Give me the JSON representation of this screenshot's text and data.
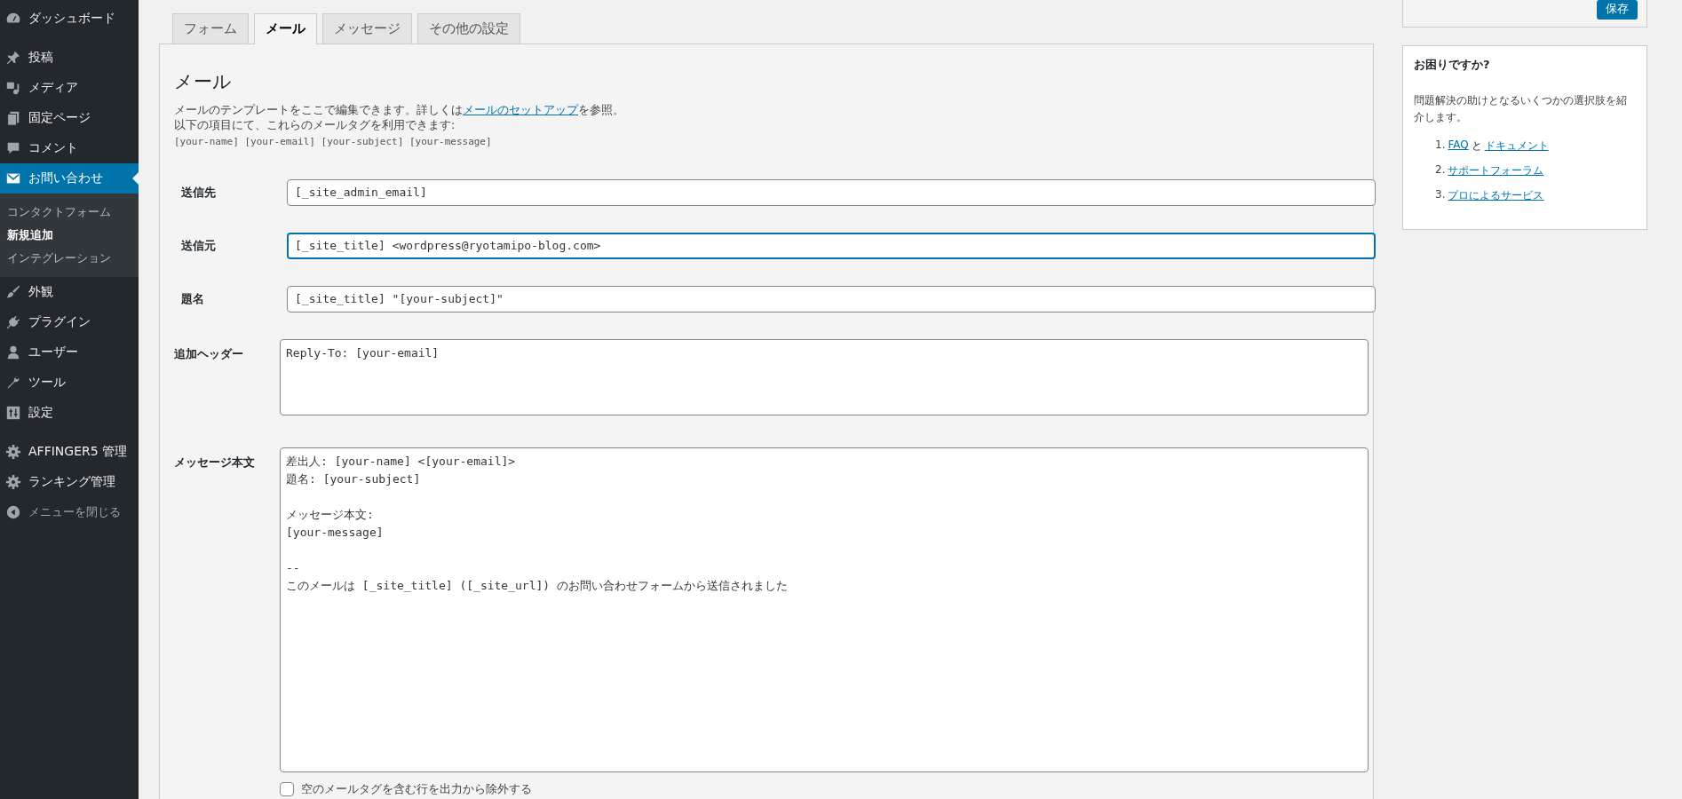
{
  "sidebar": {
    "items": [
      {
        "label": "ダッシュボード",
        "kind": "gauge",
        "selected": false
      },
      {
        "label": "投稿",
        "kind": "pin",
        "selected": false
      },
      {
        "label": "メディア",
        "kind": "media",
        "selected": false
      },
      {
        "label": "固定ページ",
        "kind": "pages",
        "selected": false
      },
      {
        "label": "コメント",
        "kind": "comment",
        "selected": false
      },
      {
        "label": "お問い合わせ",
        "kind": "mail",
        "selected": true,
        "children": [
          {
            "label": "コンタクトフォーム",
            "selected": false
          },
          {
            "label": "新規追加",
            "selected": true
          },
          {
            "label": "インテグレーション",
            "selected": false
          }
        ]
      },
      {
        "label": "外観",
        "kind": "brush",
        "selected": false
      },
      {
        "label": "プラグイン",
        "kind": "plug",
        "selected": false
      },
      {
        "label": "ユーザー",
        "kind": "user",
        "selected": false
      },
      {
        "label": "ツール",
        "kind": "wrench",
        "selected": false
      },
      {
        "label": "設定",
        "kind": "settings",
        "selected": false
      },
      {
        "label": "AFFINGER5 管理",
        "kind": "gear",
        "selected": false
      },
      {
        "label": "ランキング管理",
        "kind": "gear",
        "selected": false
      },
      {
        "label": "メニューを閉じる",
        "kind": "collapse",
        "selected": false
      }
    ]
  },
  "tabs": [
    {
      "label": "フォーム",
      "selected": false
    },
    {
      "label": "メール",
      "selected": true
    },
    {
      "label": "メッセージ",
      "selected": false
    },
    {
      "label": "その他の設定",
      "selected": false
    }
  ],
  "panel": {
    "title": "メール",
    "intro_before": "メールのテンプレートをここで編集できます。詳しくは",
    "intro_link": "メールのセットアップ",
    "intro_after": "を参照。",
    "tags_note": "以下の項目にて、これらのメールタグを利用できます:",
    "tags": "[your-name] [your-email] [your-subject] [your-message]",
    "fields": [
      {
        "kind": "input",
        "label": "送信先",
        "value": "[_site_admin_email]",
        "focused": false
      },
      {
        "kind": "input",
        "label": "送信元",
        "value": "[_site_title] <wordpress@ryotamipo-blog.com>",
        "focused": true
      },
      {
        "kind": "input",
        "label": "題名",
        "value": "[_site_title] \"[your-subject]\"",
        "focused": false
      },
      {
        "kind": "textarea",
        "label": "追加ヘッダー",
        "value": "Reply-To: [your-email]",
        "focused": false
      },
      {
        "kind": "textarea",
        "label": "メッセージ本文",
        "value": "差出人: [your-name] <[your-email]>\n題名: [your-subject]\n\nメッセージ本文:\n[your-message]\n\n--\nこのメールは [_site_title] ([_site_url]) のお問い合わせフォームから送信されました",
        "focused": false
      }
    ],
    "exclude_checkbox": {
      "label": "空のメールタグを含む行を出力から除外する",
      "checked": false
    }
  },
  "save_button": "保存",
  "help": {
    "title": "お困りですか?",
    "text": "問題解決の助けとなるいくつかの選択肢を紹介します。",
    "links": [
      {
        "number": "1.",
        "parts": [
          "FAQ",
          "と",
          "ドキュメント"
        ]
      },
      {
        "number": "2.",
        "parts": [
          "サポートフォーラム"
        ]
      },
      {
        "number": "3.",
        "parts": [
          "プロによるサービス"
        ]
      }
    ]
  }
}
